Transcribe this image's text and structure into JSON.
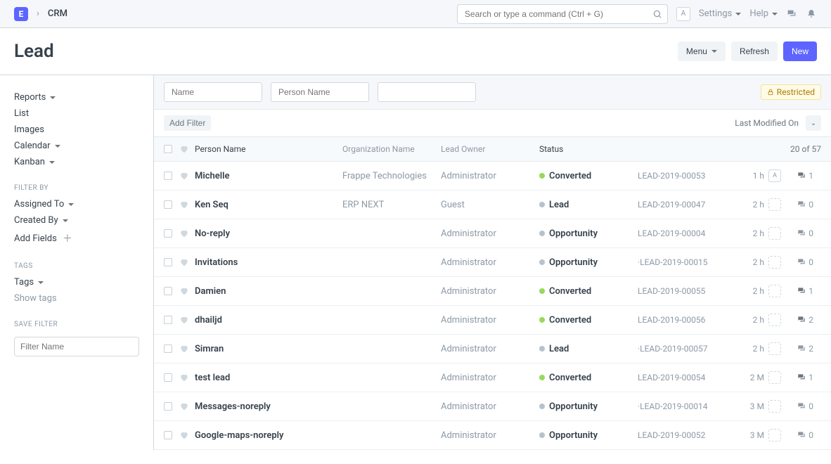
{
  "topbar": {
    "logo_letter": "E",
    "breadcrumb": "CRM",
    "search_placeholder": "Search or type a command (Ctrl + G)",
    "avatar_letter": "A",
    "settings": "Settings",
    "help": "Help"
  },
  "page": {
    "title": "Lead",
    "menu_btn": "Menu",
    "refresh_btn": "Refresh",
    "new_btn": "New"
  },
  "sidebar": {
    "views": [
      {
        "label": "Reports",
        "dropdown": true
      },
      {
        "label": "List",
        "dropdown": false
      },
      {
        "label": "Images",
        "dropdown": false
      },
      {
        "label": "Calendar",
        "dropdown": true
      },
      {
        "label": "Kanban",
        "dropdown": true
      }
    ],
    "filter_by_label": "FILTER BY",
    "filter_by": [
      {
        "label": "Assigned To",
        "dropdown": true
      },
      {
        "label": "Created By",
        "dropdown": true
      }
    ],
    "add_fields": "Add Fields",
    "tags_label": "TAGS",
    "tags_item": "Tags",
    "show_tags": "Show tags",
    "save_filter_label": "SAVE FILTER",
    "filter_name_placeholder": "Filter Name"
  },
  "filters": {
    "name_placeholder": "Name",
    "person_placeholder": "Person Name",
    "restricted": "Restricted",
    "add_filter": "Add Filter",
    "sort_by": "Last Modified On"
  },
  "columns": {
    "person_name": "Person Name",
    "org_name": "Organization Name",
    "lead_owner": "Lead Owner",
    "status": "Status",
    "count": "20 of 57"
  },
  "rows": [
    {
      "name": "Michelle",
      "org": "Frappe Technologies",
      "owner": "Administrator",
      "status": "Converted",
      "status_color": "green",
      "id": "LEAD-2019-00053",
      "time": "1 h",
      "avatar": "A",
      "avatar_dashed": false,
      "comments": 1,
      "has_comments": true
    },
    {
      "name": "Ken Seq",
      "org": "ERP NEXT",
      "owner": "Guest",
      "status": "Lead",
      "status_color": "grey",
      "id": "LEAD-2019-00047",
      "time": "2 h",
      "avatar": "",
      "avatar_dashed": true,
      "comments": 0,
      "has_comments": false
    },
    {
      "name": "No-reply",
      "org": "",
      "owner": "Administrator",
      "status": "Opportunity",
      "status_color": "grey",
      "id": "LEAD-2019-00004",
      "time": "2 h",
      "avatar": "",
      "avatar_dashed": true,
      "comments": 0,
      "has_comments": false
    },
    {
      "name": "Invitations",
      "org": "",
      "owner": "Administrator",
      "status": "Opportunity",
      "status_color": "grey",
      "id": "·LEAD-2019-00015",
      "time": "2 h",
      "avatar": "",
      "avatar_dashed": true,
      "comments": 0,
      "has_comments": false
    },
    {
      "name": "Damien",
      "org": "",
      "owner": "Administrator",
      "status": "Converted",
      "status_color": "green",
      "id": "LEAD-2019-00055",
      "time": "2 h",
      "avatar": "",
      "avatar_dashed": true,
      "comments": 1,
      "has_comments": true
    },
    {
      "name": "dhailjd",
      "org": "",
      "owner": "Administrator",
      "status": "Converted",
      "status_color": "green",
      "id": "LEAD-2019-00056",
      "time": "2 h",
      "avatar": "",
      "avatar_dashed": true,
      "comments": 2,
      "has_comments": true
    },
    {
      "name": "Simran",
      "org": "",
      "owner": "Administrator",
      "status": "Lead",
      "status_color": "grey",
      "id": "·LEAD-2019-00057",
      "time": "2 h",
      "avatar": "",
      "avatar_dashed": true,
      "comments": 2,
      "has_comments": false
    },
    {
      "name": "test lead",
      "org": "",
      "owner": "Administrator",
      "status": "Converted",
      "status_color": "green",
      "id": "LEAD-2019-00054",
      "time": "2 M",
      "avatar": "",
      "avatar_dashed": true,
      "comments": 1,
      "has_comments": true
    },
    {
      "name": "Messages-noreply",
      "org": "",
      "owner": "Administrator",
      "status": "Opportunity",
      "status_color": "grey",
      "id": "·LEAD-2019-00014",
      "time": "3 M",
      "avatar": "",
      "avatar_dashed": true,
      "comments": 0,
      "has_comments": false
    },
    {
      "name": "Google-maps-noreply",
      "org": "",
      "owner": "Administrator",
      "status": "Opportunity",
      "status_color": "grey",
      "id": "LEAD-2019-00052",
      "time": "3 M",
      "avatar": "",
      "avatar_dashed": true,
      "comments": 0,
      "has_comments": false
    }
  ]
}
